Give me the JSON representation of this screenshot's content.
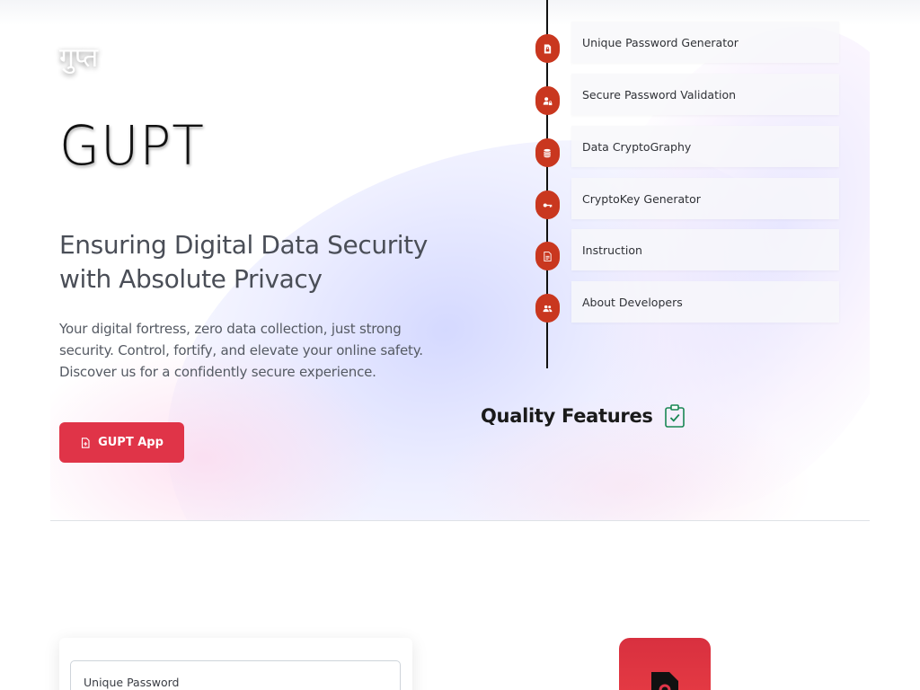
{
  "hero": {
    "logo_text": "गुप्त",
    "brand": "GUPT",
    "tagline_line1": "Ensuring Digital Data Security",
    "tagline_line2": "with Absolute Privacy",
    "description": "Your digital fortress, zero data collection, just strong security. Control, fortify, and elevate your online safety. Discover us for a confidently secure experience.",
    "app_button_label": "GUPT App",
    "accent_color": "#e03448"
  },
  "features": {
    "items": [
      {
        "label": "Unique Password Generator",
        "icon": "lock-file-icon"
      },
      {
        "label": "Secure Password Validation",
        "icon": "user-lock-icon"
      },
      {
        "label": "Data CryptoGraphy",
        "icon": "database-icon"
      },
      {
        "label": "CryptoKey Generator",
        "icon": "key-icon"
      },
      {
        "label": "Instruction",
        "icon": "document-icon"
      },
      {
        "label": "About Developers",
        "icon": "people-icon"
      }
    ],
    "dot_color": "#c9371f"
  },
  "quality": {
    "title": "Quality Features",
    "icon": "clipboard-check-icon"
  },
  "form": {
    "field_label": "Unique Password"
  }
}
